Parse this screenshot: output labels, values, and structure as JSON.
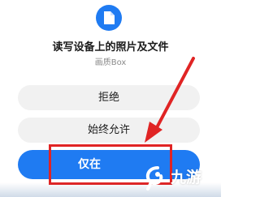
{
  "dialog": {
    "title": "读写设备上的照片及文件",
    "app_name": "画质Box",
    "buttons": {
      "deny": "拒绝",
      "always_allow": "始终允许",
      "allow_only_while_using_prefix": "仅在"
    }
  },
  "watermark": {
    "text": "九游"
  },
  "colors": {
    "accent": "#1f7bf2",
    "highlight": "#e02424",
    "button_bg": "#f1f1f1",
    "subtitle": "#8a8a8a"
  },
  "icons": {
    "app": "file-icon",
    "watermark": "nine-game-logo-icon",
    "annotation": "red-arrow-icon"
  }
}
